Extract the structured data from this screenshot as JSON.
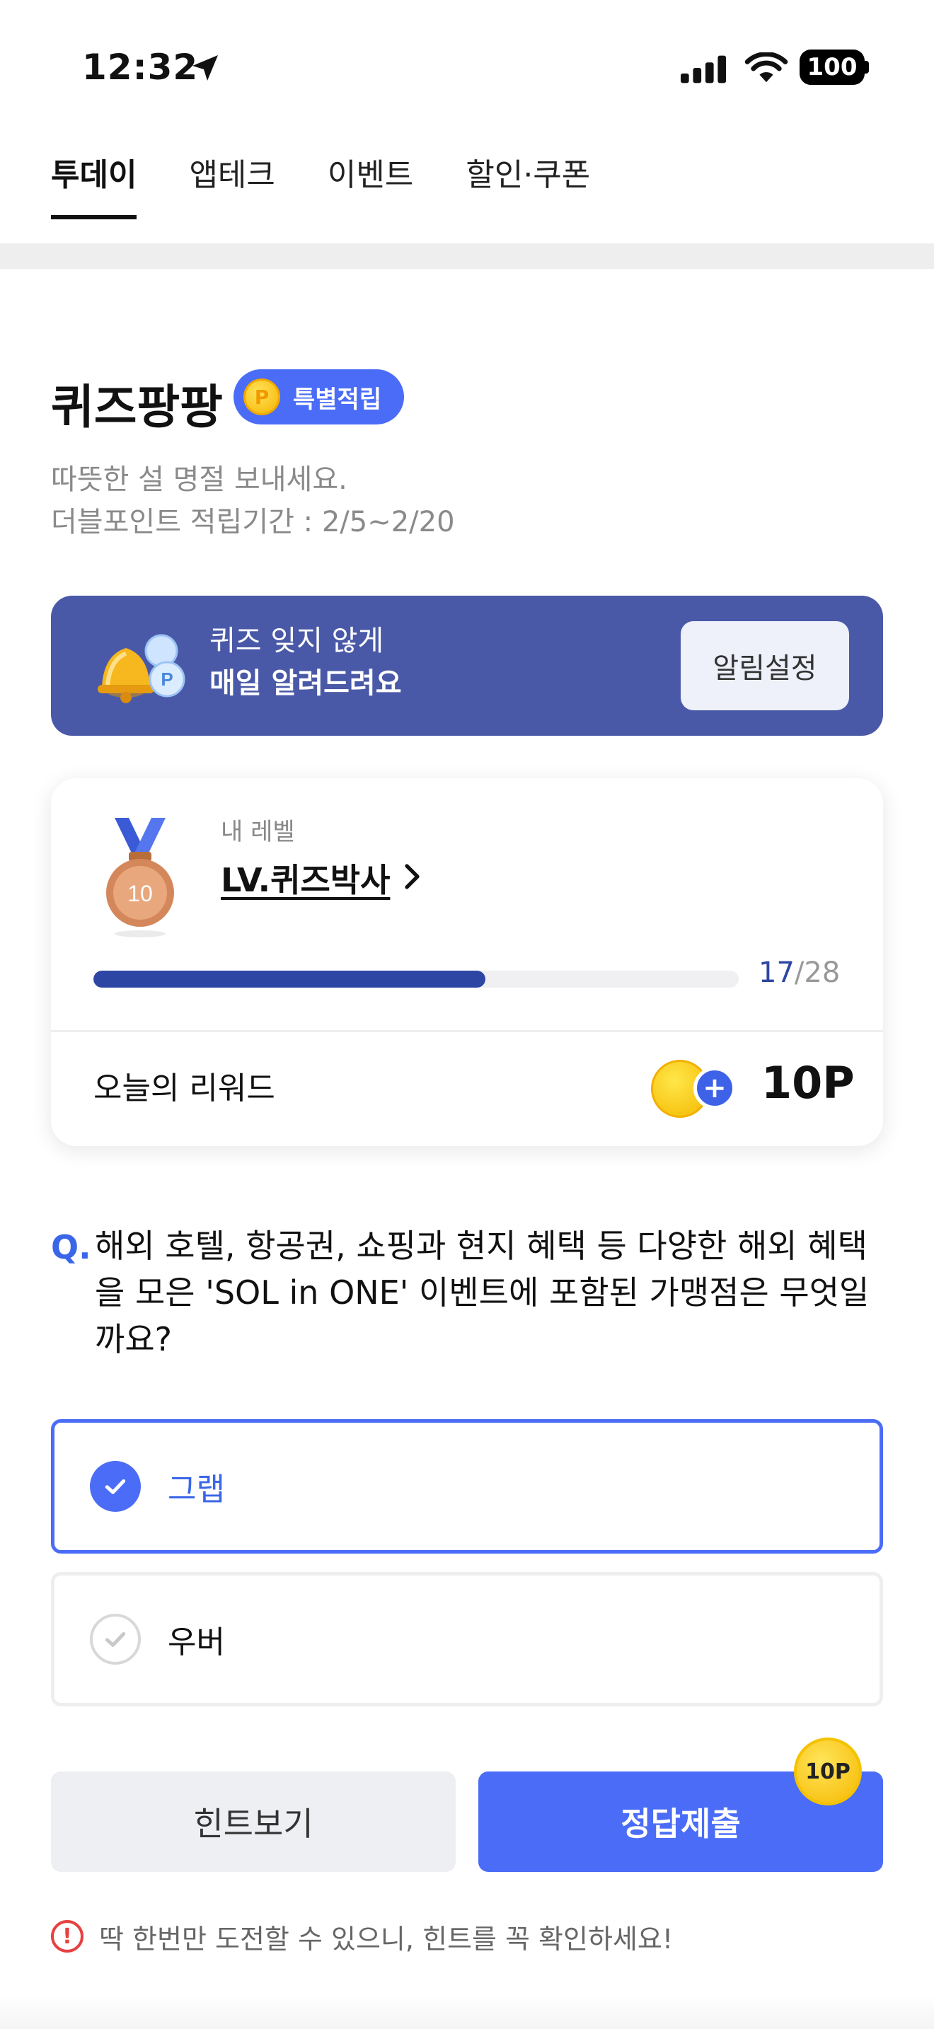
{
  "status_bar": {
    "time": "12:32",
    "battery": "100"
  },
  "tabs": [
    {
      "label": "투데이",
      "active": true
    },
    {
      "label": "앱테크",
      "active": false
    },
    {
      "label": "이벤트",
      "active": false
    },
    {
      "label": "할인·쿠폰",
      "active": false
    }
  ],
  "quiz": {
    "title": "퀴즈팡팡",
    "badge": "특별적립",
    "badge_coin": "P",
    "subtitle_line1": "따뜻한 설 명절 보내세요.",
    "subtitle_line2": "더블포인트 적립기간 : 2/5~2/20"
  },
  "banner": {
    "line1": "퀴즈 잊지 않게",
    "line2": "매일 알려드려요",
    "button": "알림설정"
  },
  "level_card": {
    "medal_number": "10",
    "caption": "내 레벨",
    "level_name": "LV.퀴즈박사",
    "progress_current": "17",
    "progress_total": "/28",
    "progress_fraction": 0.607,
    "reward_label": "오늘의 리워드",
    "reward_points": "10P"
  },
  "question": {
    "mark": "Q.",
    "text": "해외 호텔, 항공권, 쇼핑과 현지 혜택 등 다양한 해외 혜택을 모은 'SOL in ONE' 이벤트에 포함된 가맹점은 무엇일까요?"
  },
  "options": [
    {
      "label": "그랩",
      "selected": true
    },
    {
      "label": "우버",
      "selected": false
    }
  ],
  "buttons": {
    "hint": "힌트보기",
    "submit": "정답제출",
    "submit_badge": "10P"
  },
  "warning": "딱 한번만 도전할 수 있으니, 힌트를 꼭 확인하세요!",
  "colors": {
    "accent": "#4a6cf7",
    "banner": "#4a59a7",
    "progress": "#2e46a3",
    "warning": "#e84040"
  }
}
